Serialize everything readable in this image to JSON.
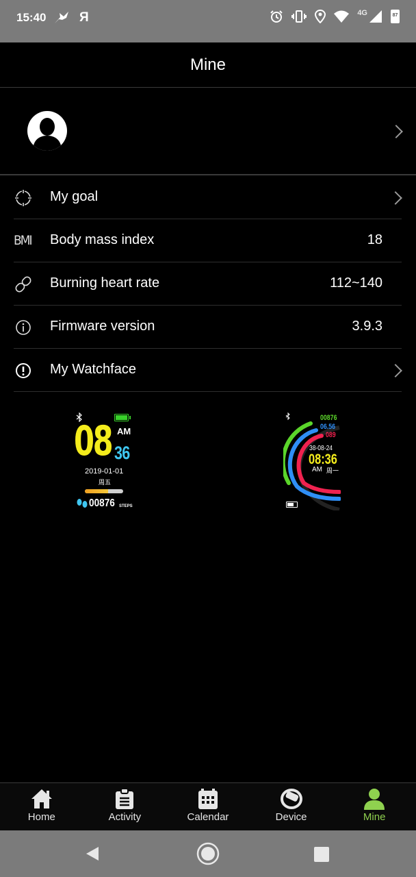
{
  "status_bar": {
    "time": "15:40",
    "left_icons": [
      "bird-notification-icon",
      "yandex-icon"
    ],
    "yandex_glyph": "Я",
    "network": "4G",
    "battery": "87",
    "right_icons": [
      "alarm-icon",
      "vibrate-icon",
      "location-icon",
      "wifi-icon",
      "signal-icon",
      "battery-icon"
    ]
  },
  "header": {
    "title": "Mine"
  },
  "profile": {
    "avatar_icon": "user-silhouette-icon",
    "chevron_icon": "chevron-right-icon"
  },
  "settings": {
    "items": [
      {
        "label": "My goal",
        "icon": "crosshair-icon",
        "value": "",
        "chevron": true
      },
      {
        "label": "Body mass index",
        "icon": "bmi-icon",
        "icon_text": "BMI",
        "value": "18",
        "chevron": false
      },
      {
        "label": "Burning heart rate",
        "icon": "link-icon",
        "value": "112~140",
        "chevron": false
      },
      {
        "label": "Firmware version",
        "icon": "info-icon",
        "value": "3.9.3",
        "chevron": false
      },
      {
        "label": "My Watchface",
        "icon": "exclamation-circle-icon",
        "value": "",
        "chevron": true
      }
    ]
  },
  "watchfaces": [
    {
      "hour": "08",
      "minute": "36",
      "ampm": "AM",
      "date": "2019-01-01",
      "weekday": "周五",
      "steps": "00876",
      "steps_unit": "STEPS",
      "colors": {
        "hour": "#f4ec1c",
        "minute": "#3fc6f0",
        "battery": "#38d12a"
      }
    },
    {
      "steps": "00876",
      "distance": "06.56",
      "heart": "089",
      "date": "38-08-24",
      "time": "08:36",
      "ampm": "AM",
      "weekday": "周一",
      "colors": {
        "steps": "#5bd52a",
        "distance": "#2f8ef5",
        "heart": "#f0224f",
        "time": "#f4ec1c"
      }
    }
  ],
  "bottom_nav": {
    "items": [
      {
        "label": "Home",
        "icon": "home-icon",
        "active": false
      },
      {
        "label": "Activity",
        "icon": "clipboard-icon",
        "active": false
      },
      {
        "label": "Calendar",
        "icon": "calendar-icon",
        "active": false
      },
      {
        "label": "Device",
        "icon": "watch-band-icon",
        "active": false
      },
      {
        "label": "Mine",
        "icon": "person-icon",
        "active": true
      }
    ],
    "active_color": "#8fd14f"
  },
  "system_nav": {
    "icons": [
      "back-icon",
      "home-circle-icon",
      "recents-icon"
    ]
  }
}
